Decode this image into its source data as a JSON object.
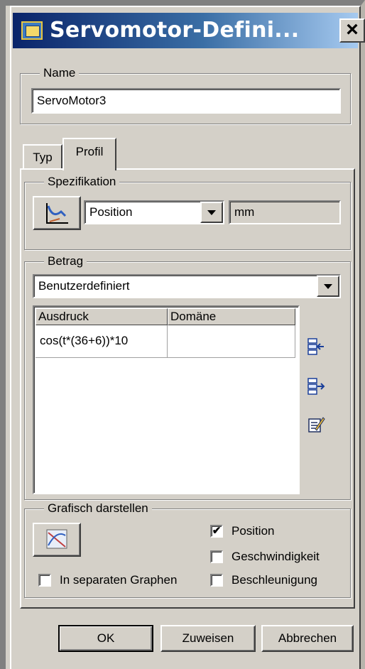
{
  "window": {
    "title": "Servomotor-Defini..."
  },
  "name_group": {
    "label": "Name",
    "value": "ServoMotor3"
  },
  "tabs": [
    {
      "label": "Typ",
      "active": false
    },
    {
      "label": "Profil",
      "active": true
    }
  ],
  "spezifikation": {
    "label": "Spezifikation",
    "selected": "Position",
    "unit": "mm"
  },
  "betrag": {
    "label": "Betrag",
    "selected": "Benutzerdefiniert",
    "table": {
      "columns": [
        "Ausdruck",
        "Domäne"
      ],
      "rows": [
        [
          "cos(t*(36+6))*10",
          ""
        ]
      ]
    }
  },
  "grafisch": {
    "label": "Grafisch darstellen",
    "options": [
      {
        "label": "Position",
        "checked": true
      },
      {
        "label": "Geschwindigkeit",
        "checked": false
      },
      {
        "label": "Beschleunigung",
        "checked": false
      }
    ],
    "separate": {
      "label": "In separaten Graphen",
      "checked": false
    }
  },
  "buttons": {
    "ok": "OK",
    "apply": "Zuweisen",
    "cancel": "Abbrechen"
  },
  "icons": {
    "title": "window-app-icon",
    "spec": "motion-profile-icon",
    "insert_row": "insert-row-icon",
    "append_row": "append-row-icon",
    "edit": "edit-expression-icon",
    "graph": "graph-plot-icon"
  },
  "colors": {
    "titlebar_start": "#0a246a",
    "titlebar_end": "#a6caf0",
    "dialog_bg": "#d4d0c8"
  }
}
